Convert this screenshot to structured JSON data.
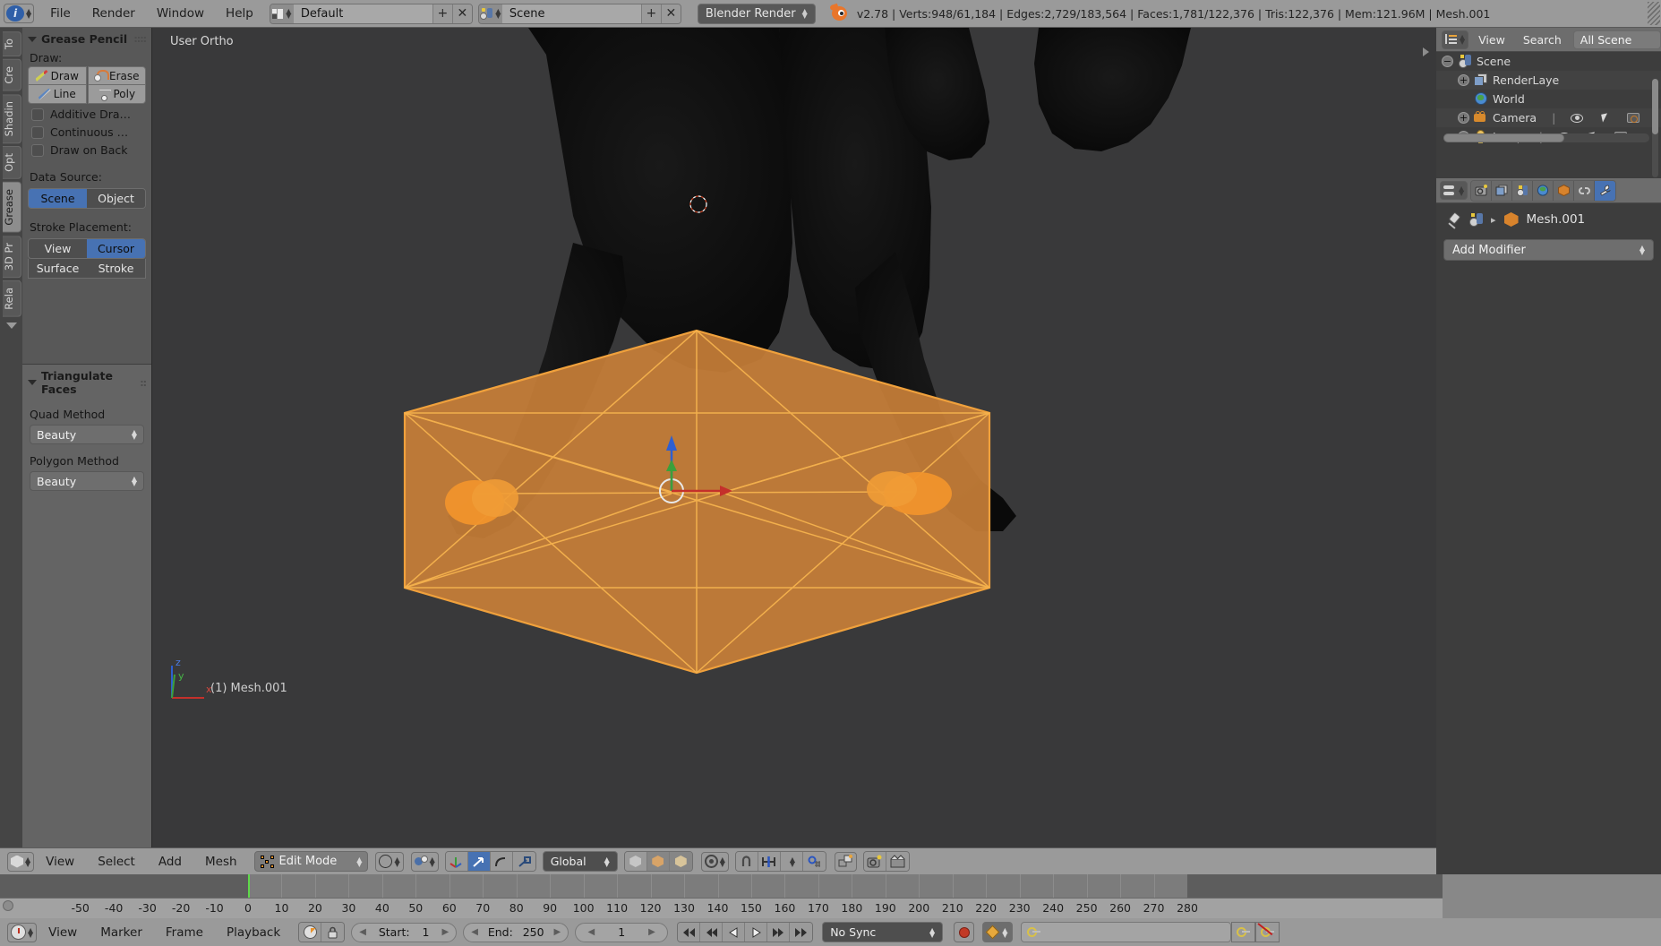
{
  "topbar": {
    "menus": [
      "File",
      "Render",
      "Window",
      "Help"
    ],
    "screen_layout": "Default",
    "scene_name": "Scene",
    "render_engine": "Blender Render",
    "version": "v2.78",
    "stats": "v2.78 | Verts:948/61,184 | Edges:2,729/183,564 | Faces:1,781/122,376 | Tris:122,376 | Mem:121.96M | Mesh.001",
    "add_icon": "+",
    "remove_icon": "✕"
  },
  "toolshelf": {
    "tabs": [
      "To",
      "Cre",
      "Shadin",
      "Opt",
      "Grease",
      "3D Pr",
      "Rela"
    ],
    "active_tab": "Grease",
    "panel_title": "Grease Pencil",
    "draw_label": "Draw:",
    "draw_buttons": [
      "Draw",
      "Erase",
      "Line",
      "Poly"
    ],
    "checkboxes": [
      "Additive Dra…",
      "Continuous …",
      "Draw on Back"
    ],
    "data_source_label": "Data Source:",
    "data_source_options": [
      "Scene",
      "Object"
    ],
    "data_source_active": "Scene",
    "stroke_placement_label": "Stroke Placement:",
    "stroke_placement_options": [
      "View",
      "Cursor"
    ],
    "stroke_placement_active": "Cursor",
    "stroke_placement_row2": [
      "Surface",
      "Stroke"
    ]
  },
  "operator_panel": {
    "title": "Triangulate Faces",
    "quad_method_label": "Quad Method",
    "quad_method_value": "Beauty",
    "polygon_method_label": "Polygon Method",
    "polygon_method_value": "Beauty"
  },
  "viewport": {
    "view_label": "User Ortho",
    "object_label": "(1) Mesh.001",
    "axis_labels": [
      "z",
      "y",
      "x"
    ],
    "colors": {
      "background": "#39393a",
      "selected_mesh": "#e8912c",
      "mesh_fill": "#c87f38",
      "axis_x": "#c4302b",
      "axis_y": "#3ba03b",
      "axis_z": "#2f5fd0"
    }
  },
  "viewport_header": {
    "menus": [
      "View",
      "Select",
      "Add",
      "Mesh"
    ],
    "mode": "Edit Mode",
    "orientation": "Global",
    "select_modes": [
      "vertex",
      "edge",
      "face"
    ],
    "pivot": "median-point",
    "snap_enabled": false,
    "proportional": "off"
  },
  "outliner": {
    "menus": [
      "View",
      "Search"
    ],
    "display_mode": "All Scene",
    "rows": [
      {
        "label": "Scene",
        "icon": "scene-icon",
        "indent": 0,
        "expandable": true,
        "expanded": true
      },
      {
        "label": "RenderLaye",
        "icon": "renderlayers-icon",
        "indent": 1,
        "expandable": true,
        "expanded": false
      },
      {
        "label": "World",
        "icon": "world-icon",
        "indent": 1,
        "expandable": false,
        "expanded": false
      },
      {
        "label": "Camera",
        "icon": "camera-icon",
        "indent": 1,
        "expandable": true,
        "expanded": false
      },
      {
        "label": "Lamp",
        "icon": "lamp-icon",
        "indent": 1,
        "expandable": true,
        "expanded": false
      }
    ]
  },
  "properties": {
    "tabs": [
      "render-icon",
      "renderlayers-icon",
      "scene-icon",
      "world-icon",
      "object-icon",
      "constraints-icon",
      "modifier-icon"
    ],
    "active_tab": "modifier-icon",
    "breadcrumb_object": "Mesh.001",
    "add_modifier_label": "Add Modifier"
  },
  "timeline": {
    "ruler_ticks": [
      -50,
      -40,
      -30,
      -20,
      -10,
      0,
      10,
      20,
      30,
      40,
      50,
      60,
      70,
      80,
      90,
      100,
      110,
      120,
      130,
      140,
      150,
      160,
      170,
      180,
      190,
      200,
      210,
      220,
      230,
      240,
      250,
      260,
      270,
      280
    ],
    "range_start": 0,
    "range_end": 250,
    "current_frame_marker": 0,
    "menus": [
      "View",
      "Marker",
      "Frame",
      "Playback"
    ],
    "start_label": "Start:",
    "start_value": "1",
    "end_label": "End:",
    "end_value": "250",
    "current_frame": "1",
    "sync_mode": "No Sync",
    "playback_buttons": [
      "jump-start",
      "prev-keyframe",
      "play-reverse",
      "play",
      "next-keyframe",
      "jump-end"
    ],
    "keying_set_value": ""
  }
}
